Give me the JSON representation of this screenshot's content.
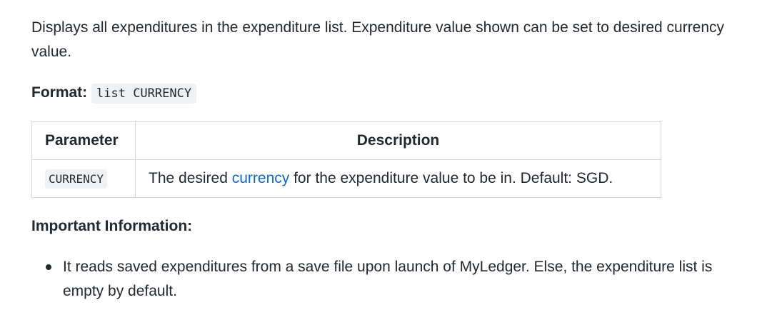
{
  "intro": "Displays all expenditures in the expenditure list. Expenditure value shown can be set to desired currency value.",
  "format": {
    "label": "Format:",
    "command": "list CURRENCY"
  },
  "table": {
    "headers": {
      "parameter": "Parameter",
      "description": "Description"
    },
    "row": {
      "param": "CURRENCY",
      "desc_before": "The desired ",
      "desc_link": "currency",
      "desc_after": " for the expenditure value to be in. Default: SGD."
    }
  },
  "important": {
    "heading": "Important Information:",
    "items": [
      "It reads saved expenditures from a save file upon launch of MyLedger. Else, the expenditure list is empty by default."
    ]
  },
  "colors": {
    "link": "#0969da",
    "code_background": "#f0f1f3",
    "border": "#d0d7de"
  }
}
